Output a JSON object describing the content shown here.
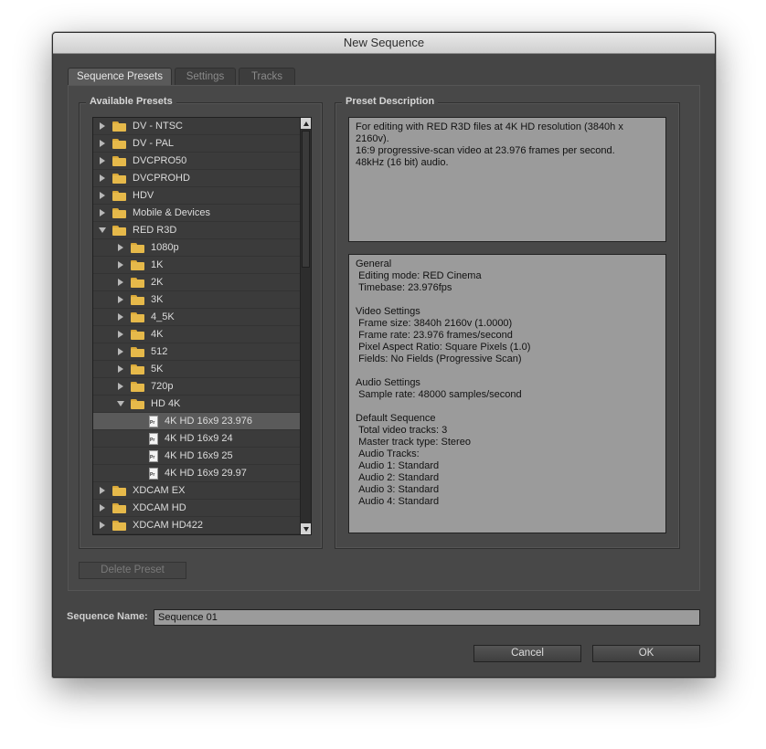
{
  "window": {
    "title": "New Sequence"
  },
  "tabs": [
    {
      "label": "Sequence Presets",
      "active": true
    },
    {
      "label": "Settings",
      "active": false
    },
    {
      "label": "Tracks",
      "active": false
    }
  ],
  "available_presets": {
    "title": "Available Presets",
    "items": [
      {
        "label": "DV - NTSC",
        "type": "folder",
        "level": 0,
        "expanded": false
      },
      {
        "label": "DV - PAL",
        "type": "folder",
        "level": 0,
        "expanded": false
      },
      {
        "label": "DVCPRO50",
        "type": "folder",
        "level": 0,
        "expanded": false
      },
      {
        "label": "DVCPROHD",
        "type": "folder",
        "level": 0,
        "expanded": false
      },
      {
        "label": "HDV",
        "type": "folder",
        "level": 0,
        "expanded": false
      },
      {
        "label": "Mobile & Devices",
        "type": "folder",
        "level": 0,
        "expanded": false
      },
      {
        "label": "RED R3D",
        "type": "folder",
        "level": 0,
        "expanded": true
      },
      {
        "label": "1080p",
        "type": "folder",
        "level": 1,
        "expanded": false
      },
      {
        "label": "1K",
        "type": "folder",
        "level": 1,
        "expanded": false
      },
      {
        "label": "2K",
        "type": "folder",
        "level": 1,
        "expanded": false
      },
      {
        "label": "3K",
        "type": "folder",
        "level": 1,
        "expanded": false
      },
      {
        "label": "4_5K",
        "type": "folder",
        "level": 1,
        "expanded": false
      },
      {
        "label": "4K",
        "type": "folder",
        "level": 1,
        "expanded": false
      },
      {
        "label": "512",
        "type": "folder",
        "level": 1,
        "expanded": false
      },
      {
        "label": "5K",
        "type": "folder",
        "level": 1,
        "expanded": false
      },
      {
        "label": "720p",
        "type": "folder",
        "level": 1,
        "expanded": false
      },
      {
        "label": "HD 4K",
        "type": "folder",
        "level": 1,
        "expanded": true
      },
      {
        "label": "4K HD 16x9 23.976",
        "type": "file",
        "level": 2,
        "selected": true
      },
      {
        "label": "4K HD 16x9 24",
        "type": "file",
        "level": 2
      },
      {
        "label": "4K HD 16x9 25",
        "type": "file",
        "level": 2
      },
      {
        "label": "4K HD 16x9 29.97",
        "type": "file",
        "level": 2
      },
      {
        "label": "XDCAM EX",
        "type": "folder",
        "level": 0,
        "expanded": false
      },
      {
        "label": "XDCAM HD",
        "type": "folder",
        "level": 0,
        "expanded": false
      },
      {
        "label": "XDCAM HD422",
        "type": "folder",
        "level": 0,
        "expanded": false
      }
    ]
  },
  "preset_description": {
    "title": "Preset Description",
    "summary": "For editing with RED R3D files at 4K HD resolution (3840h x 2160v).\n16:9 progressive-scan video at 23.976 frames per second.\n48kHz (16 bit) audio.",
    "details": "General\n Editing mode: RED Cinema\n Timebase: 23.976fps\n\nVideo Settings\n Frame size: 3840h 2160v (1.0000)\n Frame rate: 23.976 frames/second\n Pixel Aspect Ratio: Square Pixels (1.0)\n Fields: No Fields (Progressive Scan)\n\nAudio Settings\n Sample rate: 48000 samples/second\n\nDefault Sequence\n Total video tracks: 3\n Master track type: Stereo\n Audio Tracks:\n Audio 1: Standard\n Audio 2: Standard\n Audio 3: Standard\n Audio 4: Standard"
  },
  "buttons": {
    "delete_preset": "Delete Preset",
    "cancel": "Cancel",
    "ok": "OK"
  },
  "sequence_name": {
    "label": "Sequence Name:",
    "value": "Sequence 01"
  },
  "colors": {
    "folder": "#e6b94a",
    "panel_bg": "#454545",
    "field_bg": "#9b9b9b",
    "selected_row": "#5a5a5a"
  }
}
